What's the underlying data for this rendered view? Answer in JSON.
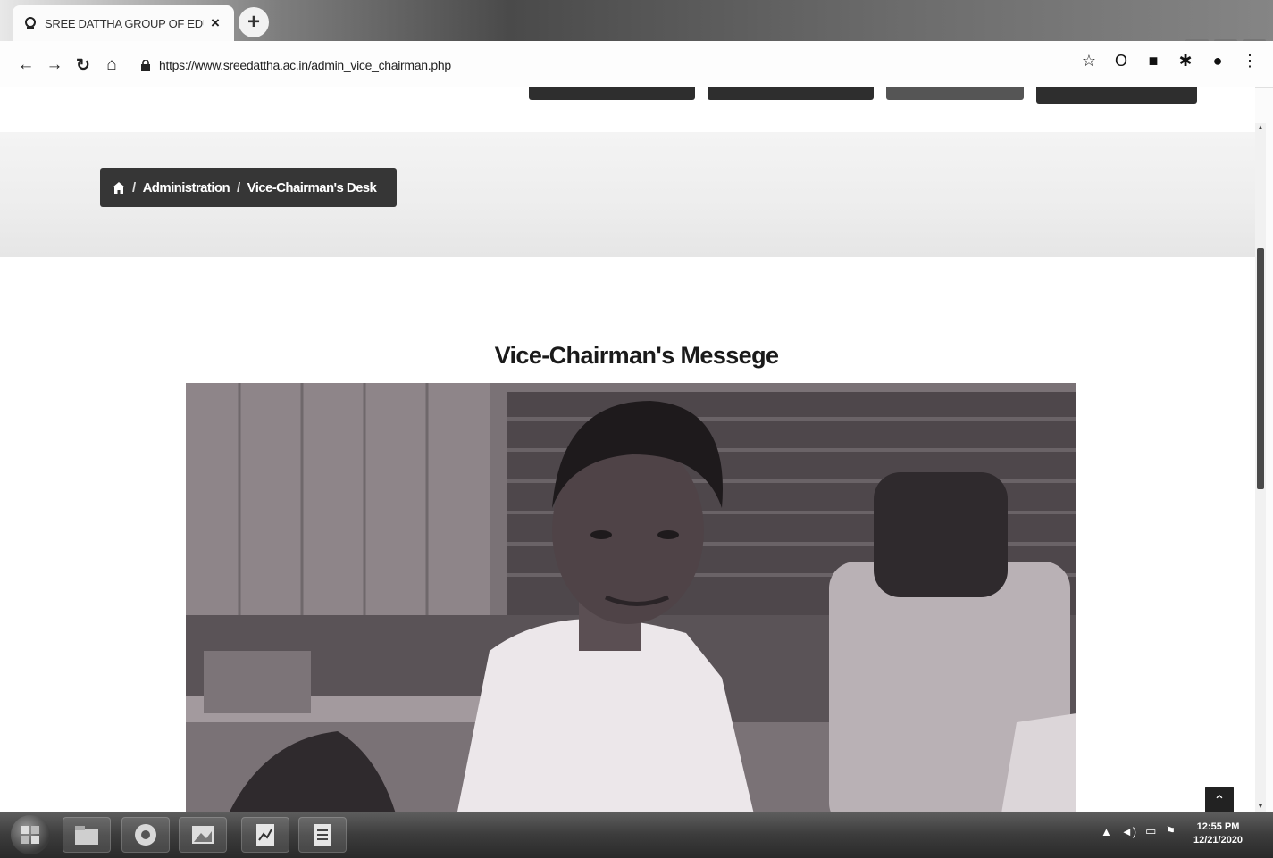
{
  "browser": {
    "tab_title": "SREE DATTHA GROUP OF EDUC/",
    "tab_close": "×",
    "new_tab": "+",
    "url": "https://www.sreedattha.ac.in/admin_vice_chairman.php",
    "nav": {
      "back": "←",
      "forward": "→",
      "reload": "↻",
      "home": "⌂"
    },
    "extensions": [
      "☆",
      "O",
      "■",
      "✱",
      "●",
      "⋮"
    ],
    "window_controls": [
      "—",
      "□",
      "✕"
    ]
  },
  "breadcrumb": {
    "separator": "/",
    "items": [
      "Administration",
      "Vice-Chairman's Desk"
    ]
  },
  "page": {
    "heading": "Vice-Chairman's Messege",
    "back_to_top": "⌃"
  },
  "scrollbar": {
    "up": "▲",
    "down": "▼"
  },
  "taskbar": {
    "clock_time": "12:55 PM",
    "clock_date": "12/21/2020",
    "tray": [
      "▲",
      "◄)",
      "▭",
      "⚑"
    ]
  },
  "colors": {
    "breadcrumb_bg": "#363636",
    "taskbar_bg": "#3c3c3c",
    "menu_bar": "#2e2e2e"
  }
}
